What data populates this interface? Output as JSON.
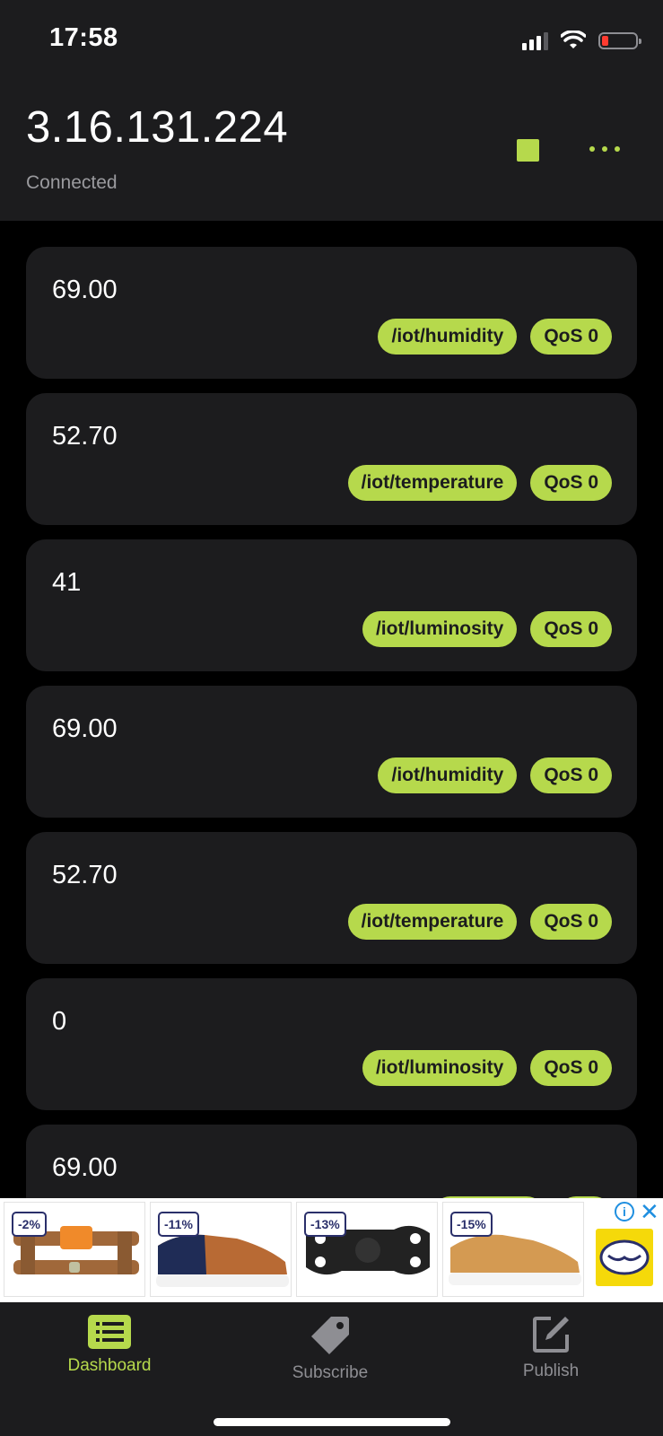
{
  "status_bar": {
    "time": "17:58",
    "signal_icon": "signal-bars-icon",
    "wifi_icon": "wifi-icon",
    "battery_icon": "battery-low-icon",
    "battery_color": "#ff3b30"
  },
  "header": {
    "host": "3.16.131.224",
    "status": "Connected",
    "stop_icon": "stop-square-icon",
    "more_icon": "more-dots-icon"
  },
  "colors": {
    "accent": "#b6d94c",
    "card_bg": "#1c1c1e",
    "background": "#000000",
    "inactive": "#8e8e93"
  },
  "messages": [
    {
      "value": "69.00",
      "topic": "/iot/humidity",
      "qos": "QoS 0"
    },
    {
      "value": "52.70",
      "topic": "/iot/temperature",
      "qos": "QoS 0"
    },
    {
      "value": "41",
      "topic": "/iot/luminosity",
      "qos": "QoS 0"
    },
    {
      "value": "69.00",
      "topic": "/iot/humidity",
      "qos": "QoS 0"
    },
    {
      "value": "52.70",
      "topic": "/iot/temperature",
      "qos": "QoS 0"
    },
    {
      "value": "0",
      "topic": "/iot/luminosity",
      "qos": "QoS 0"
    },
    {
      "value": "69.00",
      "topic": "",
      "qos": ""
    }
  ],
  "ad": {
    "items": [
      {
        "discount": "-2%",
        "icon": "pipe-valve-product"
      },
      {
        "discount": "-11%",
        "icon": "sneaker-brown-navy-product"
      },
      {
        "discount": "-13%",
        "icon": "black-mount-product"
      },
      {
        "discount": "-15%",
        "icon": "sneaker-tan-product"
      }
    ],
    "info_icon": "info-icon",
    "info_symbol": "i",
    "close_icon": "close-icon",
    "close_symbol": "✕",
    "logo_icon": "marketplace-logo-icon"
  },
  "tabbar": {
    "tabs": [
      {
        "label": "Dashboard",
        "icon": "list-icon",
        "active": true
      },
      {
        "label": "Subscribe",
        "icon": "tag-icon",
        "active": false
      },
      {
        "label": "Publish",
        "icon": "edit-icon",
        "active": false
      }
    ]
  }
}
